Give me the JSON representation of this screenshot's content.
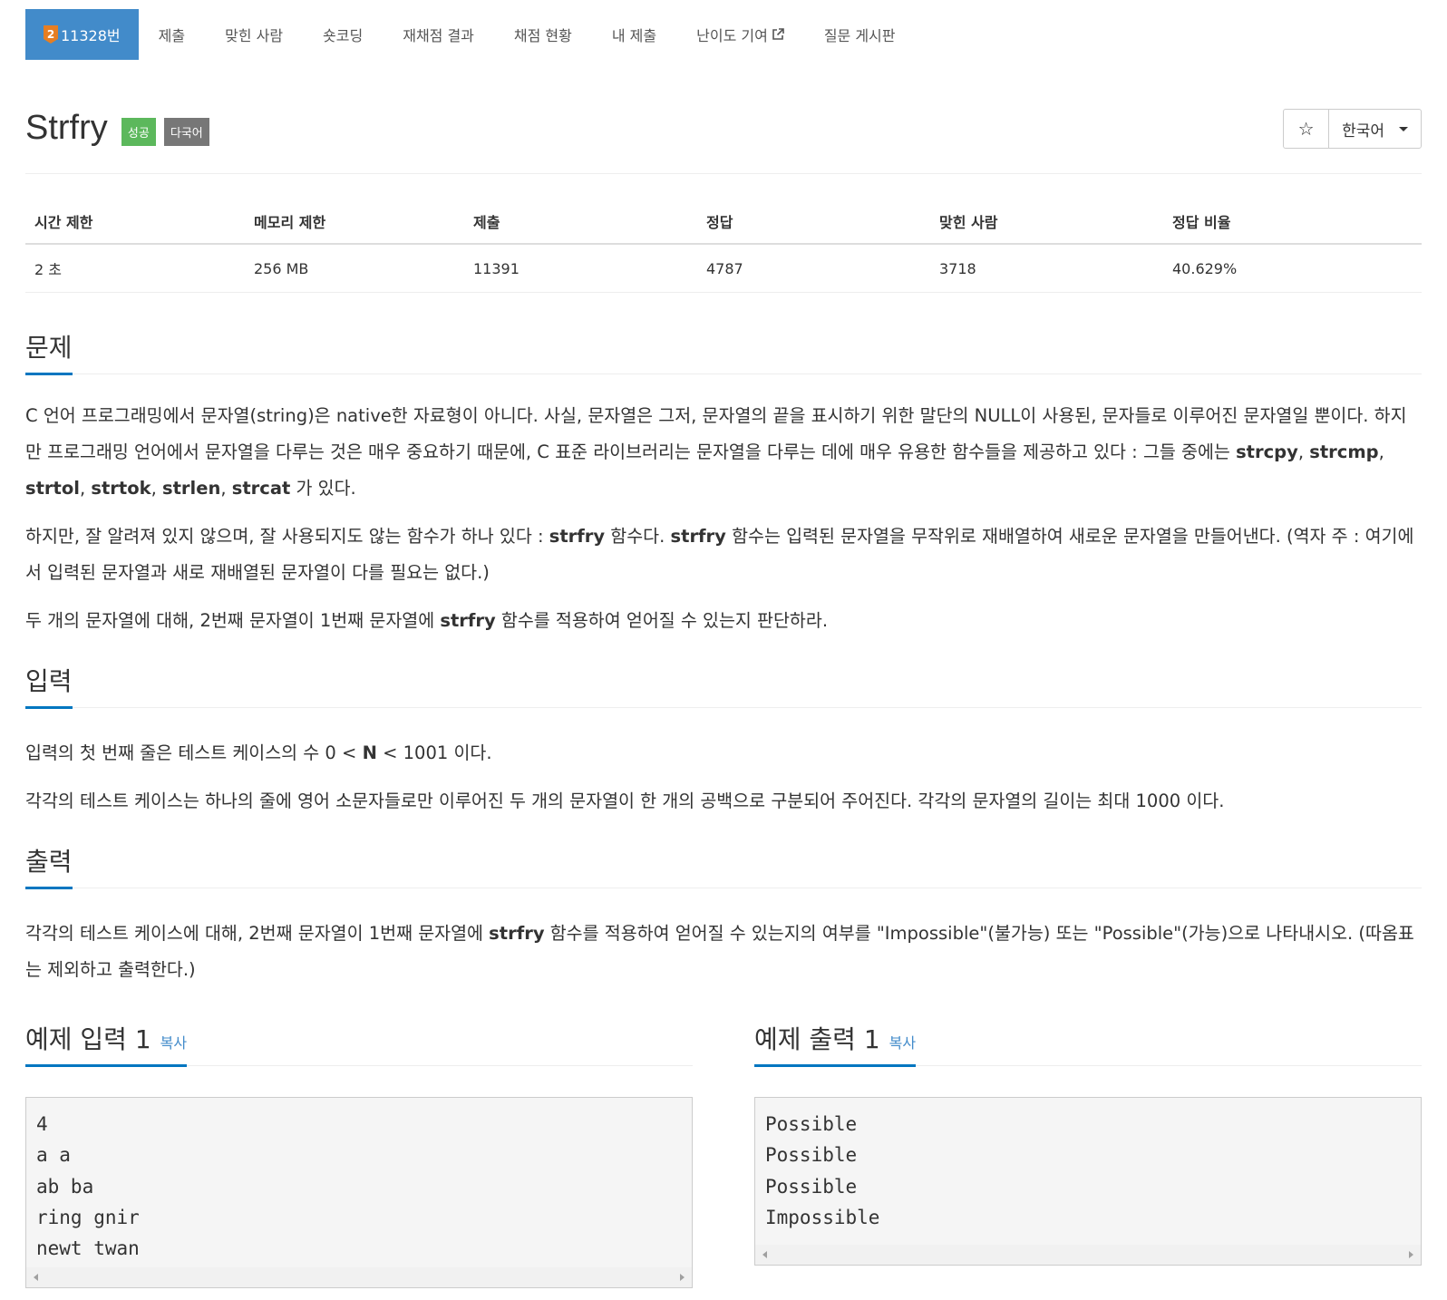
{
  "nav": {
    "problem_tier": "2",
    "problem_number": "11328번",
    "items": [
      "제출",
      "맞힌 사람",
      "숏코딩",
      "재채점 결과",
      "채점 현황",
      "내 제출",
      "난이도 기여",
      "질문 게시판"
    ]
  },
  "header": {
    "title": "Strfry",
    "badge_success": "성공",
    "badge_multilang": "다국어",
    "star": "☆",
    "language": "한국어"
  },
  "stats": {
    "headers": [
      "시간 제한",
      "메모리 제한",
      "제출",
      "정답",
      "맞힌 사람",
      "정답 비율"
    ],
    "values": [
      "2 초",
      "256 MB",
      "11391",
      "4787",
      "3718",
      "40.629%"
    ]
  },
  "problem": {
    "heading": "문제",
    "p1_a": "C 언어 프로그래밍에서 문자열(string)은 native한 자료형이 아니다. 사실, 문자열은 그저, 문자열의 끝을 표시하기 위한 말단의 NULL이 사용된, 문자들로 이루어진 문자열일 뿐이다. 하지만 프로그래밍 언어에서 문자열을 다루는 것은 매우 중요하기 때문에, C 표준 라이브러리는 문자열을 다루는 데에 매우 유용한 함수들을 제공하고 있다 : 그들 중에는 ",
    "funcs": [
      "strcpy",
      "strcmp",
      "strtol",
      "strtok",
      "strlen",
      "strcat"
    ],
    "p1_end": " 가 있다.",
    "p2_a": "하지만, 잘 알려져 있지 않으며, 잘 사용되지도 않는 함수가 하나 있다 : ",
    "p2_b": "strfry",
    "p2_c": " 함수다. ",
    "p2_d": "strfry",
    "p2_e": " 함수는 입력된 문자열을 무작위로 재배열하여 새로운 문자열을 만들어낸다. (역자 주 : 여기에서 입력된 문자열과 새로 재배열된 문자열이 다를 필요는 없다.)",
    "p3_a": "두 개의 문자열에 대해, 2번째 문자열이 1번째 문자열에 ",
    "p3_b": "strfry",
    "p3_c": " 함수를 적용하여 얻어질 수 있는지 판단하라."
  },
  "input": {
    "heading": "입력",
    "p1_a": "입력의 첫 번째 줄은 테스트 케이스의 수 0 < ",
    "p1_b": "N",
    "p1_c": " < 1001 이다.",
    "p2": "각각의 테스트 케이스는 하나의 줄에 영어 소문자들로만 이루어진 두 개의 문자열이 한 개의 공백으로 구분되어 주어진다. 각각의 문자열의 길이는 최대 1000 이다."
  },
  "output": {
    "heading": "출력",
    "p1_a": "각각의 테스트 케이스에 대해, 2번째 문자열이 1번째 문자열에 ",
    "p1_b": "strfry",
    "p1_c": " 함수를 적용하여 얻어질 수 있는지의 여부를 \"Impossible\"(불가능) 또는 \"Possible\"(가능)으로 나타내시오. (따옴표는 제외하고 출력한다.)"
  },
  "samples": {
    "input_heading": "예제 입력 1",
    "output_heading": "예제 출력 1",
    "copy_label": "복사",
    "input_text": "4\na a\nab ba\nring gnir\nnewt twan",
    "output_text": "Possible\nPossible\nPossible\nImpossible"
  }
}
